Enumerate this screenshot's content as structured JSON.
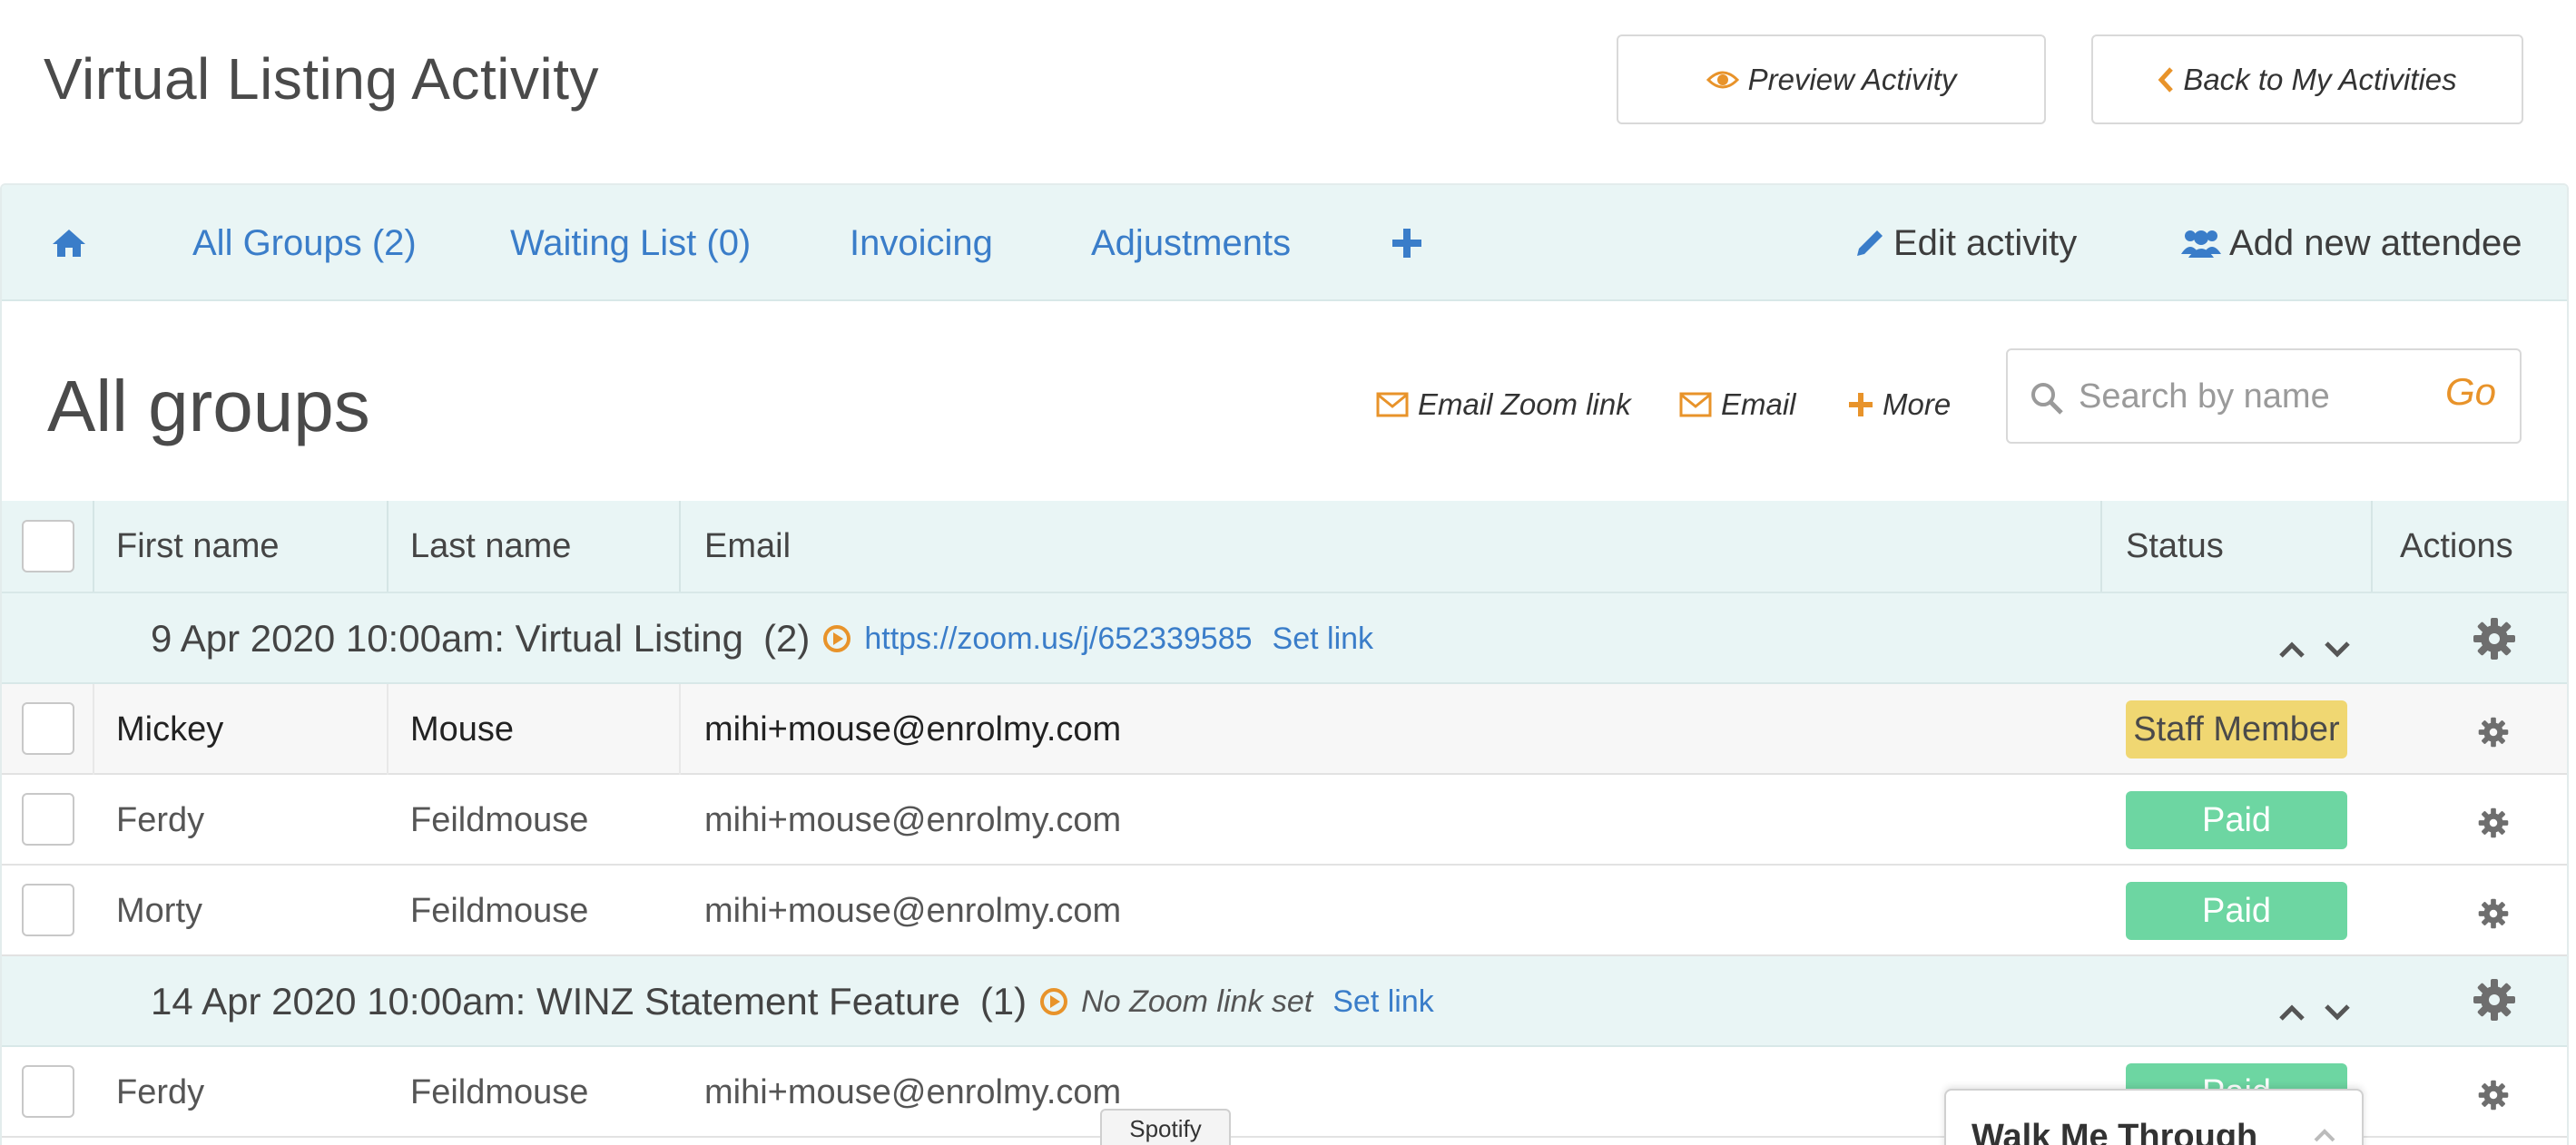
{
  "header": {
    "title": "Virtual Listing Activity",
    "preview_label": "Preview Activity",
    "back_label": "Back to My Activities"
  },
  "nav": {
    "home_icon": "home-icon",
    "tabs": [
      {
        "label": "All Groups (2)"
      },
      {
        "label": "Waiting List (0)"
      },
      {
        "label": "Invoicing"
      },
      {
        "label": "Adjustments"
      }
    ],
    "add_icon": "plus-icon",
    "edit_label": "Edit activity",
    "add_attendee_label": "Add new attendee"
  },
  "section": {
    "title": "All groups",
    "email_zoom_label": "Email Zoom link",
    "email_label": "Email",
    "more_label": "More",
    "search_placeholder": "Search by name",
    "go_label": "Go"
  },
  "table": {
    "columns": [
      "First name",
      "Last name",
      "Email",
      "Status",
      "Actions"
    ],
    "groups": [
      {
        "label": "9 Apr 2020 10:00am: Virtual Listing",
        "count": "(2)",
        "zoom_link": "https://zoom.us/j/652339585",
        "set_link": "Set link",
        "rows": [
          {
            "first": "Mickey",
            "last": "Mouse",
            "email": "mihi+mouse@enrolmy.com",
            "status": "Staff Member"
          },
          {
            "first": "Ferdy",
            "last": "Feildmouse",
            "email": "mihi+mouse@enrolmy.com",
            "status": "Paid"
          },
          {
            "first": "Morty",
            "last": "Feildmouse",
            "email": "mihi+mouse@enrolmy.com",
            "status": "Paid"
          }
        ]
      },
      {
        "label": "14 Apr 2020 10:00am: WINZ Statement Feature",
        "count": "(1)",
        "zoom_none": "No Zoom link set",
        "set_link": "Set link",
        "rows": [
          {
            "first": "Ferdy",
            "last": "Feildmouse",
            "email": "mihi+mouse@enrolmy.com",
            "status": "Paid"
          }
        ]
      }
    ]
  },
  "overlays": {
    "spotify_label": "Spotify",
    "walkme_label": "Walk Me Through"
  },
  "colors": {
    "accent_orange": "#e8932a",
    "link_blue": "#3a7dc9",
    "nav_bg": "#e9f5f5",
    "paid_green": "#6dd6a2",
    "staff_yellow": "#f0d772"
  }
}
